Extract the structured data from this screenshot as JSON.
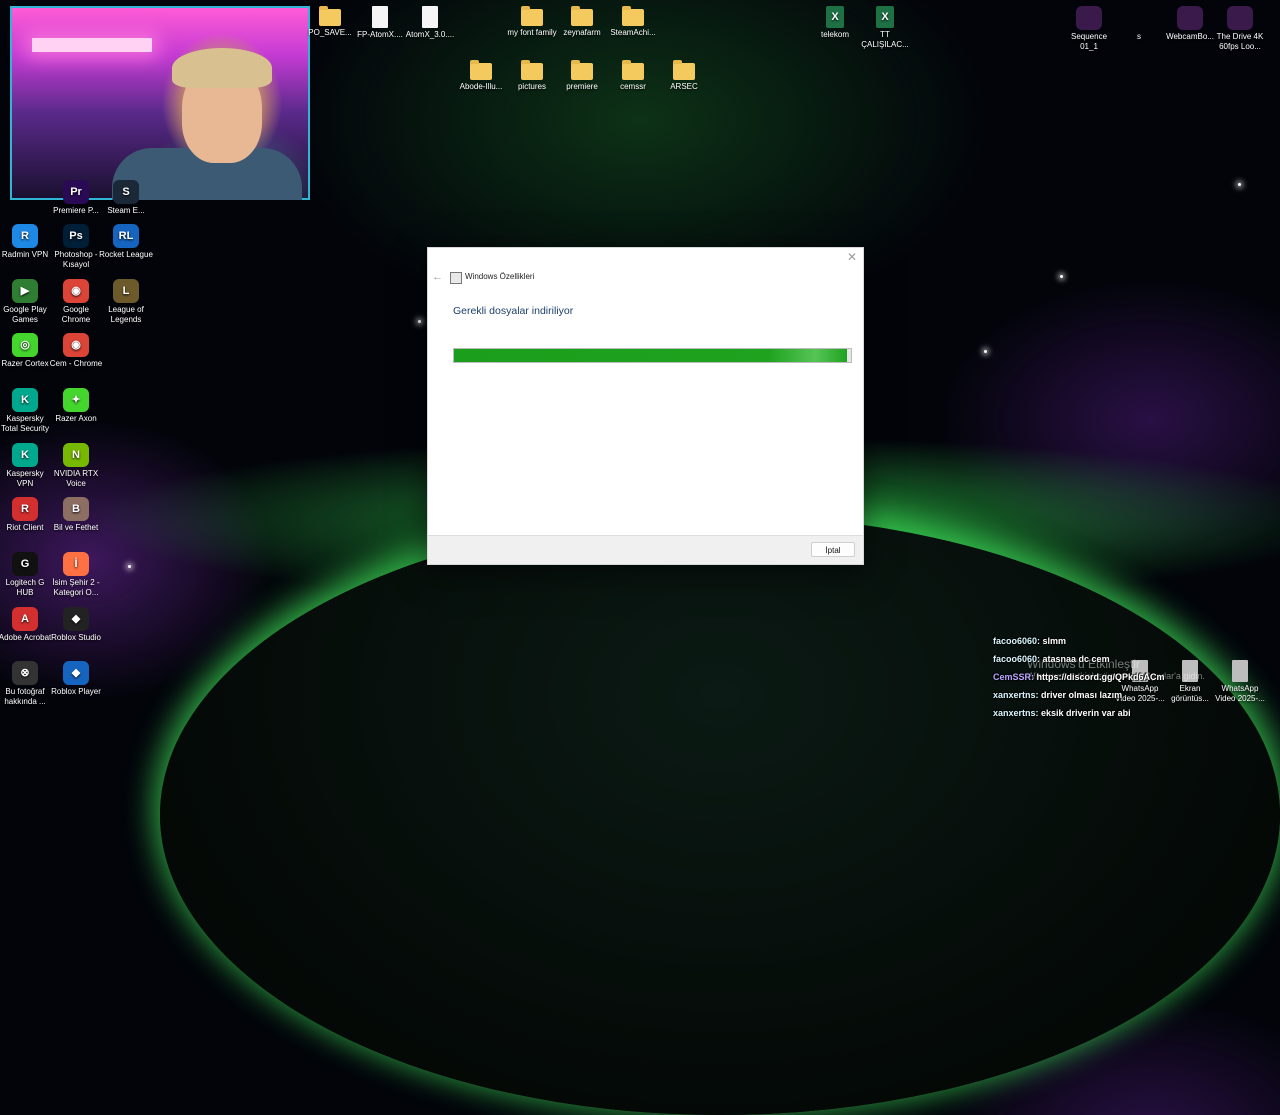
{
  "desktop": {
    "top_icons_row1": [
      {
        "label": "PO_SAVE...",
        "kind": "folder"
      },
      {
        "label": "FP-AtomX....",
        "kind": "file"
      },
      {
        "label": "AtomX_3.0....",
        "kind": "file"
      },
      {
        "label": "my font family",
        "kind": "folder"
      },
      {
        "label": "zeynafarm",
        "kind": "folder"
      },
      {
        "label": "SteamAchi...",
        "kind": "folder"
      },
      {
        "label": "telekom",
        "kind": "excel"
      },
      {
        "label": "TT ÇALIŞILAC...",
        "kind": "excel"
      },
      {
        "label": "Sequence 01_1",
        "kind": "video"
      },
      {
        "label": "s",
        "kind": "blank"
      },
      {
        "label": "WebcamBo...",
        "kind": "video"
      },
      {
        "label": "The Drive 4K 60fps Loo...",
        "kind": "video"
      }
    ],
    "top_icons_row2": [
      {
        "label": "Abode-Illu...",
        "kind": "folder"
      },
      {
        "label": "pictures",
        "kind": "folder"
      },
      {
        "label": "premiere",
        "kind": "folder"
      },
      {
        "label": "cemssr",
        "kind": "folder"
      },
      {
        "label": "ARSEC",
        "kind": "folder"
      }
    ],
    "left_icons": [
      {
        "label": "Premiere P...",
        "color": "#2a0a55",
        "text": "Pr"
      },
      {
        "label": "Steam E...",
        "color": "#1b2838",
        "text": "S"
      },
      {
        "label": "Radmin VPN",
        "color": "#1e88e5",
        "text": "R"
      },
      {
        "label": "Photoshop - Kısayol",
        "color": "#001e36",
        "text": "Ps"
      },
      {
        "label": "Rocket League",
        "color": "#1565c0",
        "text": "RL"
      },
      {
        "label": "Google Play Games",
        "color": "#2e7d32",
        "text": "▶"
      },
      {
        "label": "Google Chrome",
        "color": "#db4437",
        "text": "◉"
      },
      {
        "label": "League of Legends",
        "color": "#6d5a2a",
        "text": "L"
      },
      {
        "label": "Razer Cortex",
        "color": "#44d62c",
        "text": "◎"
      },
      {
        "label": "Cem - Chrome",
        "color": "#db4437",
        "text": "◉"
      },
      {
        "label": "Kaspersky Total Security",
        "color": "#00a88e",
        "text": "K"
      },
      {
        "label": "Razer Axon",
        "color": "#44d62c",
        "text": "✦"
      },
      {
        "label": "Kaspersky VPN",
        "color": "#00a88e",
        "text": "K"
      },
      {
        "label": "NVIDIA RTX Voice",
        "color": "#76b900",
        "text": "N"
      },
      {
        "label": "Riot Client",
        "color": "#d32f2f",
        "text": "R"
      },
      {
        "label": "Bil ve Fethet",
        "color": "#8d6e63",
        "text": "B"
      },
      {
        "label": "Logitech G HUB",
        "color": "#111111",
        "text": "G"
      },
      {
        "label": "İsim Şehir 2 - Kategori O...",
        "color": "#ff7043",
        "text": "İ"
      },
      {
        "label": "Adobe Acrobat",
        "color": "#d32f2f",
        "text": "A"
      },
      {
        "label": "Roblox Studio",
        "color": "#222222",
        "text": "◆"
      },
      {
        "label": "Bu fotoğraf hakkında ...",
        "color": "#333333",
        "text": "⊗"
      },
      {
        "label": "Roblox Player",
        "color": "#1565c0",
        "text": "◆"
      }
    ],
    "bottom_right_icons": [
      {
        "label": "WhatsApp Video 2025-..."
      },
      {
        "label": "Ekran görüntüs..."
      },
      {
        "label": "WhatsApp Video 2025-..."
      }
    ]
  },
  "dialog": {
    "title": "Windows Özellikleri",
    "heading": "Gerekli dosyalar indiriliyor",
    "progress": 0.99,
    "cancel_label": "İptal",
    "back_icon": "←",
    "close_icon": "✕"
  },
  "activation": {
    "line1": "Windows'u Etkinleştir",
    "line2": "Windows'u etkinleştirmek için Ayarlar'a gidin."
  },
  "chat": [
    {
      "user": "facoo6060:",
      "text": "slmm",
      "special": false
    },
    {
      "user": "facoo6060:",
      "text": "atasnaa dc cem",
      "special": false
    },
    {
      "user": "CemSSR:",
      "text": "https://discord.gg/QPkd6ACm",
      "special": true
    },
    {
      "user": "xanxertns:",
      "text": "driver olması lazım",
      "special": false
    },
    {
      "user": "xanxertns:",
      "text": "eksik driverin var abi",
      "special": false
    }
  ]
}
